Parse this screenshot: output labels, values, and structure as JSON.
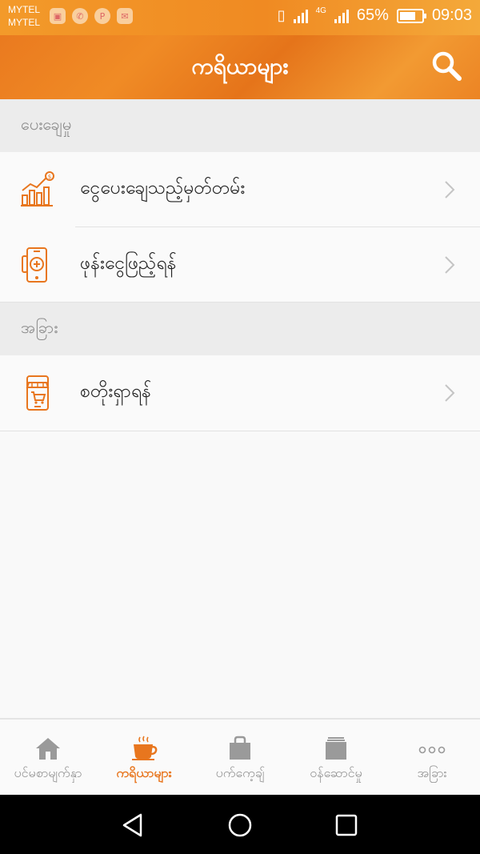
{
  "status": {
    "carrier_line1": "MYTEL",
    "carrier_line2": "MYTEL",
    "network": "4G",
    "battery_percent": "65%",
    "time": "09:03"
  },
  "header": {
    "title": "ကရိယာများ"
  },
  "sections": [
    {
      "title": "ပေးချေမှု",
      "items": [
        {
          "label": "ငွေပေးချေသည့်မှတ်တမ်း",
          "icon": "payment-history-chart-icon"
        },
        {
          "label": "ဖုန်းငွေဖြည့်ရန်",
          "icon": "phone-topup-icon"
        }
      ]
    },
    {
      "title": "အခြား",
      "items": [
        {
          "label": "စတိုးရှာရန်",
          "icon": "store-locator-icon"
        }
      ]
    }
  ],
  "tabs": [
    {
      "label": "ပင်မစာမျက်နှာ",
      "icon": "home-icon",
      "active": false
    },
    {
      "label": "ကရိယာများ",
      "icon": "coffee-cup-icon",
      "active": true
    },
    {
      "label": "ပက်ကေ့ချ်",
      "icon": "package-bag-icon",
      "active": false
    },
    {
      "label": "ဝန်ဆောင်မှု",
      "icon": "services-stack-icon",
      "active": false
    },
    {
      "label": "အခြား",
      "icon": "more-dots-icon",
      "active": false
    }
  ],
  "colors": {
    "accent": "#e8761e",
    "header_bg": "#ea7a1f",
    "section_bg": "#ececec",
    "inactive_tab": "#8f8f8f"
  }
}
